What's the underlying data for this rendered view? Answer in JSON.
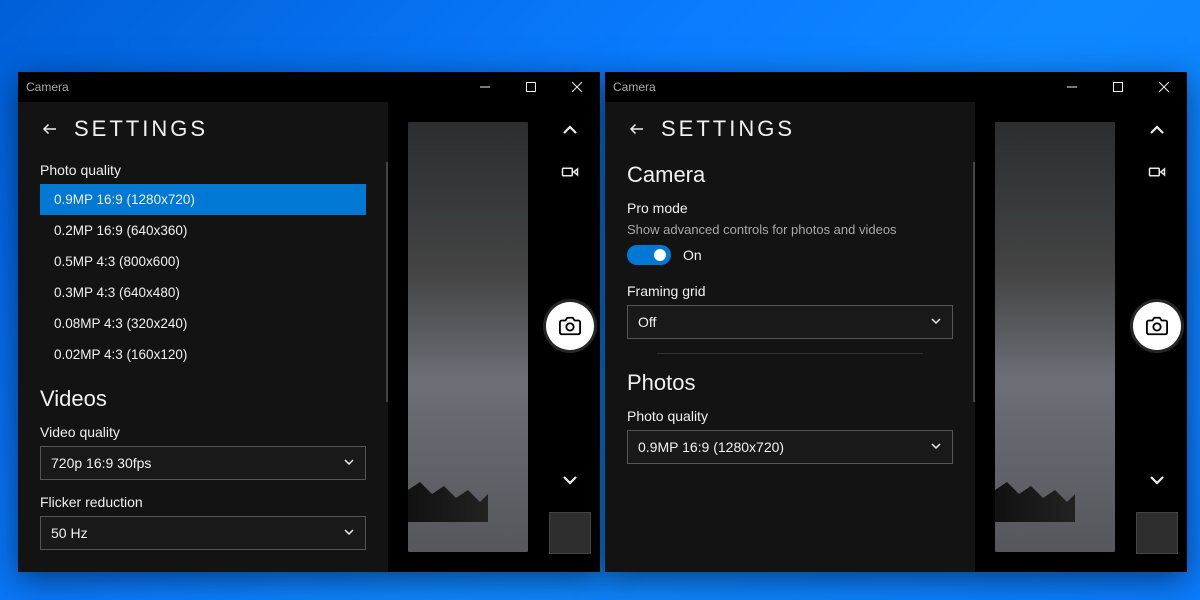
{
  "app_title": "Camera",
  "settings_title": "SETTINGS",
  "left_window": {
    "photo_quality_label": "Photo quality",
    "photo_quality_options": [
      "0.9MP 16:9 (1280x720)",
      "0.2MP 16:9 (640x360)",
      "0.5MP 4:3 (800x600)",
      "0.3MP 4:3 (640x480)",
      "0.08MP 4:3 (320x240)",
      "0.02MP 4:3 (160x120)"
    ],
    "photo_quality_selected_index": 0,
    "videos_heading": "Videos",
    "video_quality_label": "Video quality",
    "video_quality_value": "720p 16:9 30fps",
    "flicker_label": "Flicker reduction",
    "flicker_value": "50 Hz"
  },
  "right_window": {
    "camera_heading": "Camera",
    "pro_mode_label": "Pro mode",
    "pro_mode_sub": "Show advanced controls for photos and videos",
    "pro_mode_state": "On",
    "framing_grid_label": "Framing grid",
    "framing_grid_value": "Off",
    "photos_heading": "Photos",
    "photo_quality_label": "Photo quality",
    "photo_quality_value": "0.9MP 16:9 (1280x720)"
  }
}
